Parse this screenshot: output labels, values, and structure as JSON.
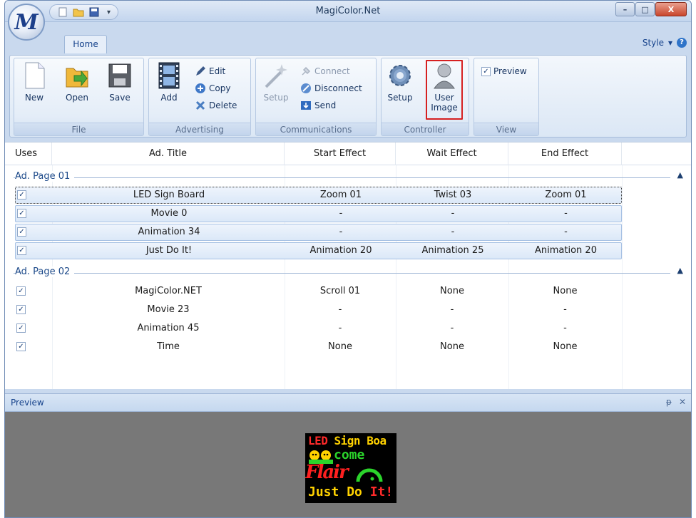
{
  "window": {
    "title": "MagiColor.Net",
    "app_logo": "M",
    "minimize": "–",
    "maximize": "□",
    "close": "X"
  },
  "tabs": {
    "home": "Home"
  },
  "style_menu": {
    "label": "Style",
    "arrow": "▾",
    "help": "?"
  },
  "ribbon": {
    "file": {
      "label": "File",
      "new": "New",
      "open": "Open",
      "save": "Save"
    },
    "advertising": {
      "label": "Advertising",
      "add": "Add",
      "edit": "Edit",
      "copy": "Copy",
      "delete": "Delete"
    },
    "communications": {
      "label": "Communications",
      "setup": "Setup",
      "connect": "Connect",
      "disconnect": "Disconnect",
      "send": "Send"
    },
    "controller": {
      "label": "Controller",
      "setup": "Setup",
      "user_image_line1": "User",
      "user_image_line2": "Image"
    },
    "view": {
      "label": "View",
      "preview": "Preview",
      "preview_checked": true
    }
  },
  "grid": {
    "columns": [
      "Uses",
      "Ad. Title",
      "Start Effect",
      "Wait Effect",
      "End Effect"
    ],
    "groups": [
      {
        "name": "Ad. Page 01",
        "collapse": "▲",
        "rows": [
          {
            "title": "LED Sign Board",
            "start": "Zoom 01",
            "wait": "Twist 03",
            "end": "Zoom 01"
          },
          {
            "title": "Movie 0",
            "start": "-",
            "wait": "-",
            "end": "-"
          },
          {
            "title": "Animation 34",
            "start": "-",
            "wait": "-",
            "end": "-"
          },
          {
            "title": "Just Do It!",
            "start": "Animation 20",
            "wait": "Animation 25",
            "end": "Animation 20"
          }
        ]
      },
      {
        "name": "Ad. Page 02",
        "collapse": "▲",
        "rows": [
          {
            "title": "MagiColor.NET",
            "start": "Scroll 01",
            "wait": "None",
            "end": "None"
          },
          {
            "title": "Movie 23",
            "start": "-",
            "wait": "-",
            "end": "-"
          },
          {
            "title": "Animation 45",
            "start": "-",
            "wait": "-",
            "end": "-"
          },
          {
            "title": "Time",
            "start": "None",
            "wait": "None",
            "end": "None"
          }
        ]
      }
    ],
    "check": "✓"
  },
  "preview": {
    "title": "Preview",
    "pin": "ᵽ",
    "close": "✕",
    "led": {
      "line1_a": "LED ",
      "line1_b": "Sign",
      "line1_c": " Boa",
      "line2": "come",
      "line3": "Flair",
      "line4_a": "Just ",
      "line4_b": "Do ",
      "line4_c": "It!"
    }
  }
}
